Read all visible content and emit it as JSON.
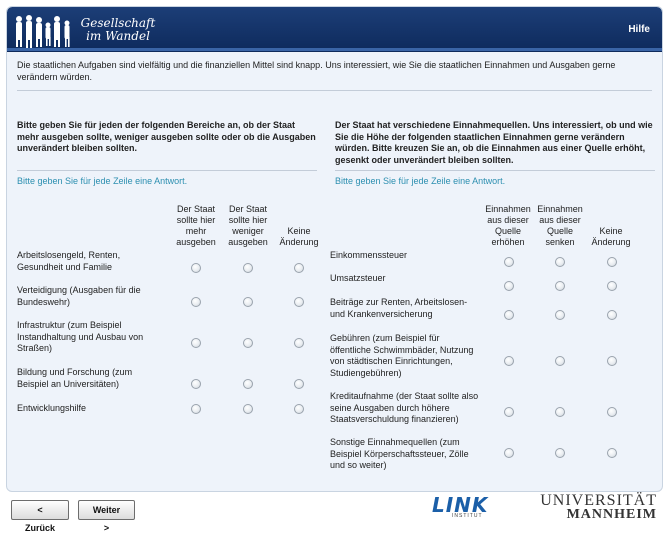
{
  "header": {
    "logo_line1": "Gesellschaft",
    "logo_line2": "im Wandel",
    "help_label": "Hilfe"
  },
  "intro_text": "Die staatlichen Aufgaben sind vielfältig und die finanziellen Mittel sind knapp. Uns interessiert, wie Sie die staatlichen Einnahmen und Ausgaben gerne verändern würden.",
  "left": {
    "question": "Bitte geben Sie für jeden der folgenden Bereiche an, ob der Staat mehr ausgeben sollte, weniger ausgeben sollte oder ob die Ausgaben unverändert bleiben sollten.",
    "instruction": "Bitte geben Sie für jede Zeile eine Antwort.",
    "columns": [
      "Der Staat sollte hier mehr ausgeben",
      "Der Staat sollte hier weniger ausgeben",
      "Keine Änderung"
    ],
    "rows": [
      "Arbeitslosengeld, Renten, Gesundheit und Familie",
      "Verteidigung (Ausgaben für die Bundeswehr)",
      "Infrastruktur (zum Beispiel Instandhaltung und Ausbau von Straßen)",
      "Bildung und Forschung (zum Beispiel an Universitäten)",
      "Entwicklungshilfe"
    ]
  },
  "right": {
    "question": "Der Staat hat verschiedene Einnahmequellen. Uns interessiert, ob und wie Sie die Höhe der folgenden staatlichen Einnahmen gerne verändern würden. Bitte kreuzen Sie an, ob die Einnahmen aus einer Quelle erhöht, gesenkt oder unverändert bleiben sollten.",
    "instruction": "Bitte geben Sie für jede Zeile eine Antwort.",
    "columns": [
      "Einnahmen aus dieser Quelle erhöhen",
      "Einnahmen aus dieser Quelle senken",
      "Keine Änderung"
    ],
    "rows": [
      "Einkommenssteuer",
      "Umsatzsteuer",
      "Beiträge zur Renten, Arbeitslosen- und Krankenversicherung",
      "Gebühren (zum Beispiel für öffentliche Schwimmbäder, Nutzung von städtischen Einrichtungen, Studiengebühren)",
      "Kreditaufnahme (der Staat sollte also seine Ausgaben durch höhere Staatsverschuldung finanzieren)",
      "Sonstige Einnahmequellen (zum Beispiel Körperschaftssteuer, Zölle und so weiter)"
    ]
  },
  "nav": {
    "back_label": "< Zurück",
    "next_label": "Weiter >"
  },
  "footer": {
    "link_logo": "LINK",
    "link_sub": "INSTITUT",
    "uni_line1": "UNIVERSITÄT",
    "uni_line2": "MANNHEIM"
  },
  "colors": {
    "header_bg": "#0e2a5c",
    "instruction": "#2c8fb0",
    "panel_bg": "#eef3fa"
  }
}
